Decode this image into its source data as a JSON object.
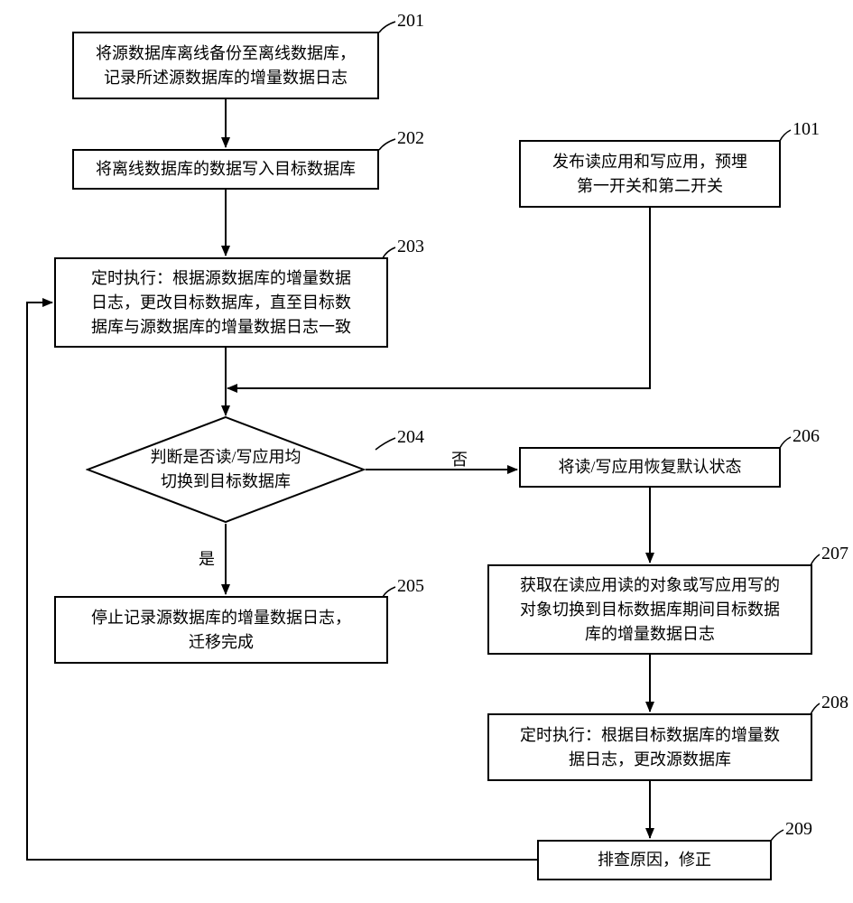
{
  "nodes": {
    "n201": {
      "text": "将源数据库离线备份至离线数据库，\n记录所述源数据库的增量数据日志",
      "label": "201"
    },
    "n202": {
      "text": "将离线数据库的数据写入目标数据库",
      "label": "202"
    },
    "n101": {
      "text": "发布读应用和写应用，预埋\n第一开关和第二开关",
      "label": "101"
    },
    "n203": {
      "text": "定时执行：根据源数据库的增量数据\n日志，更改目标数据库，直至目标数\n据库与源数据库的增量数据日志一致",
      "label": "203"
    },
    "n204": {
      "text": "判断是否读/写应用均\n切换到目标数据库",
      "label": "204"
    },
    "n205": {
      "text": "停止记录源数据库的增量数据日志，\n迁移完成",
      "label": "205"
    },
    "n206": {
      "text": "将读/写应用恢复默认状态",
      "label": "206"
    },
    "n207": {
      "text": "获取在读应用读的对象或写应用写的\n对象切换到目标数据库期间目标数据\n库的增量数据日志",
      "label": "207"
    },
    "n208": {
      "text": "定时执行：根据目标数据库的增量数\n据日志，更改源数据库",
      "label": "208"
    },
    "n209": {
      "text": "排查原因，修正",
      "label": "209"
    }
  },
  "edgeLabels": {
    "yes": "是",
    "no": "否"
  }
}
